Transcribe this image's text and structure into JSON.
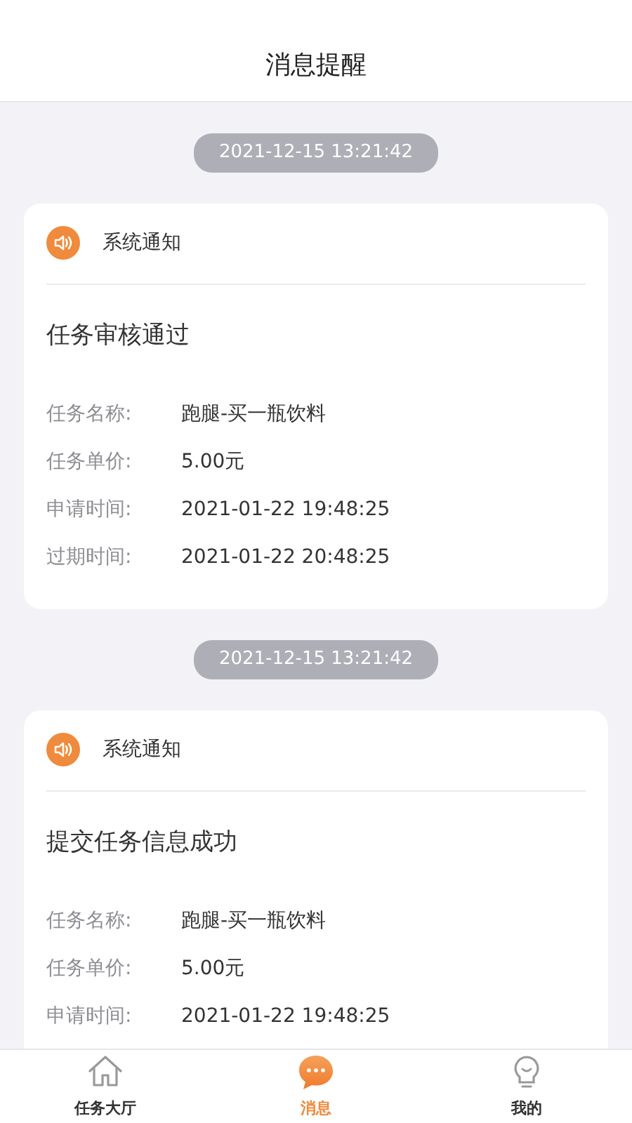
{
  "header": {
    "title": "消息提醒"
  },
  "messages": [
    {
      "time": "2021-12-15 13:21:42",
      "source": "系统通知",
      "title": "任务审核通过",
      "fields": [
        {
          "label": "任务名称:",
          "value": "跑腿-买一瓶饮料"
        },
        {
          "label": "任务单价:",
          "value": "5.00元"
        },
        {
          "label": "申请时间:",
          "value": "2021-01-22 19:48:25"
        },
        {
          "label": "过期时间:",
          "value": "2021-01-22 20:48:25"
        }
      ]
    },
    {
      "time": "2021-12-15 13:21:42",
      "source": "系统通知",
      "title": "提交任务信息成功",
      "fields": [
        {
          "label": "任务名称:",
          "value": "跑腿-买一瓶饮料"
        },
        {
          "label": "任务单价:",
          "value": "5.00元"
        },
        {
          "label": "申请时间:",
          "value": "2021-01-22 19:48:25"
        }
      ]
    }
  ],
  "tabs": [
    {
      "label": "任务大厅",
      "kind": "home",
      "selected": false
    },
    {
      "label": "消息",
      "kind": "chat",
      "selected": true
    },
    {
      "label": "我的",
      "kind": "bulb",
      "selected": false
    }
  ]
}
